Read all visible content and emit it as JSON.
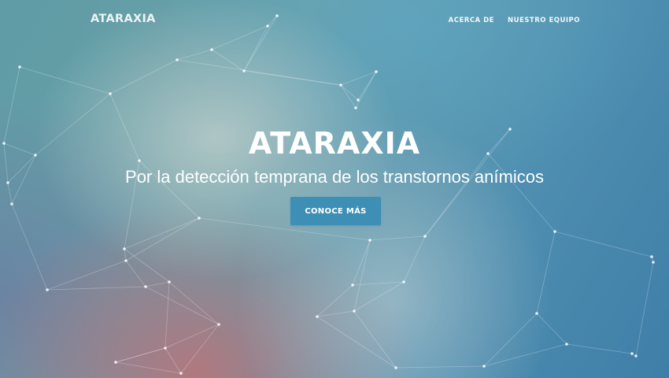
{
  "brand": {
    "name": "ATARAXIA"
  },
  "nav": {
    "items": [
      {
        "label": "ACERCA DE"
      },
      {
        "label": "NUESTRO EQUIPO"
      }
    ]
  },
  "hero": {
    "title": "ATARAXIA",
    "subtitle": "Por la detección temprana de los transtornos anímicos",
    "cta_label": "CONOCE MÁS"
  },
  "colors": {
    "cta_background": "#3d8fb5",
    "text": "#ffffff"
  }
}
